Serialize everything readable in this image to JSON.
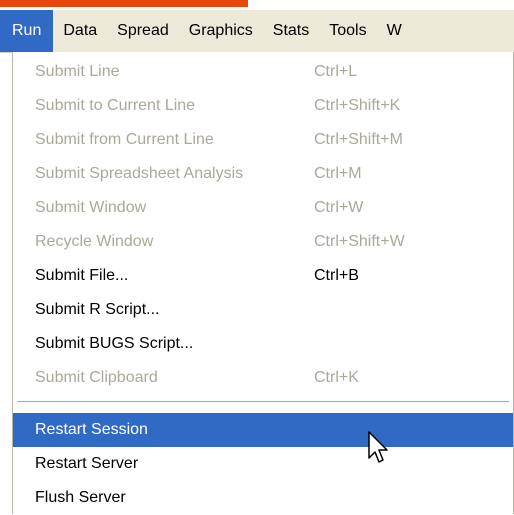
{
  "menubar": {
    "items": [
      {
        "label": "Run",
        "active": true
      },
      {
        "label": "Data",
        "active": false
      },
      {
        "label": "Spread",
        "active": false
      },
      {
        "label": "Graphics",
        "active": false
      },
      {
        "label": "Stats",
        "active": false
      },
      {
        "label": "Tools",
        "active": false
      },
      {
        "label": "W",
        "active": false
      }
    ]
  },
  "run_menu": {
    "items": [
      {
        "label": "Submit Line",
        "shortcut": "Ctrl+L",
        "enabled": false
      },
      {
        "label": "Submit to Current Line",
        "shortcut": "Ctrl+Shift+K",
        "enabled": false
      },
      {
        "label": "Submit from Current Line",
        "shortcut": "Ctrl+Shift+M",
        "enabled": false
      },
      {
        "label": "Submit Spreadsheet Analysis",
        "shortcut": "Ctrl+M",
        "enabled": false
      },
      {
        "label": "Submit Window",
        "shortcut": "Ctrl+W",
        "enabled": false
      },
      {
        "label": "Recycle Window",
        "shortcut": "Ctrl+Shift+W",
        "enabled": false
      },
      {
        "label": "Submit File...",
        "shortcut": "Ctrl+B",
        "enabled": true
      },
      {
        "label": "Submit R Script...",
        "shortcut": "",
        "enabled": true
      },
      {
        "label": "Submit BUGS Script...",
        "shortcut": "",
        "enabled": true
      },
      {
        "label": "Submit Clipboard",
        "shortcut": "Ctrl+K",
        "enabled": false
      },
      {
        "label": "Restart Session",
        "shortcut": "",
        "enabled": true,
        "highlighted": true
      },
      {
        "label": "Restart Server",
        "shortcut": "",
        "enabled": true
      },
      {
        "label": "Flush Server",
        "shortcut": "",
        "enabled": true
      }
    ]
  },
  "colors": {
    "menubar_bg": "#ece9d8",
    "highlight": "#316ac5",
    "disabled_text": "#aca899",
    "top_accent": "#e8470f"
  },
  "icons": {
    "cursor": "arrow-cursor-icon"
  }
}
